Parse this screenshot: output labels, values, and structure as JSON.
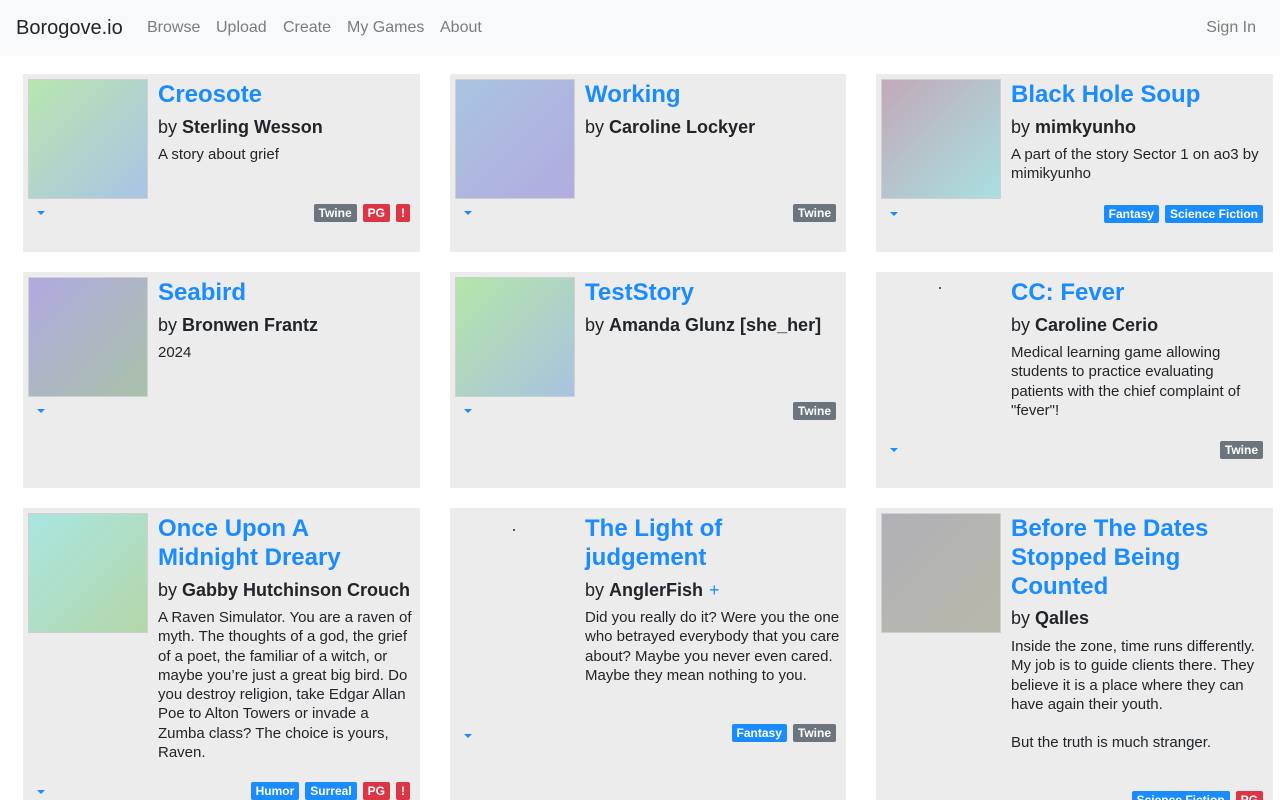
{
  "nav": {
    "brand": "Borogove.io",
    "links": [
      "Browse",
      "Upload",
      "Create",
      "My Games",
      "About"
    ],
    "sign_in": "Sign In"
  },
  "games": [
    {
      "title": "Creosote",
      "by": "by",
      "author": "Sterling Wesson",
      "description": [
        "A story about grief"
      ],
      "tags": [
        {
          "label": "Twine",
          "color": "#6c757d"
        },
        {
          "label": "PG",
          "color": "#dc3545"
        },
        {
          "label": "!",
          "color": "#dc3545"
        }
      ],
      "cover_gradient": [
        "#b8e6b0",
        "#a9c4e6"
      ]
    },
    {
      "title": "Working",
      "by": "by",
      "author": "Caroline Lockyer",
      "description": [],
      "tags": [
        {
          "label": "Twine",
          "color": "#6c757d"
        }
      ],
      "cover_gradient": [
        "#a9c4e0",
        "#b2abe0"
      ]
    },
    {
      "title": "Black Hole Soup",
      "by": "by",
      "author": "mimkyunho",
      "description": [
        "A part of the story Sector 1 on ao3 by mimikyunho"
      ],
      "tags": [
        {
          "label": "Fantasy",
          "color": "#1a8cff"
        },
        {
          "label": "Science Fiction",
          "color": "#1a8cff"
        }
      ],
      "cover_gradient": [
        "#c2a9b8",
        "#a9e0e0"
      ]
    },
    {
      "title": "Seabird",
      "by": "by",
      "author": "Bronwen Frantz",
      "description": [
        "2024"
      ],
      "tags": [],
      "cover_gradient": [
        "#b0a9e0",
        "#a9c2a9"
      ]
    },
    {
      "title": "TestStory",
      "by": "by",
      "author": "Amanda Glunz [she_her]",
      "description": [],
      "tags": [
        {
          "label": "Twine",
          "color": "#6c757d"
        }
      ],
      "cover_gradient": [
        "#b4e6a9",
        "#a9c2e0"
      ]
    },
    {
      "title": "CC: Fever",
      "by": "by",
      "author": "Caroline Cerio",
      "description": [
        "Medical learning game allowing students to practice evaluating patients with the chief complaint of \"fever\"!"
      ],
      "tags": [
        {
          "label": "Twine",
          "color": "#6c757d"
        }
      ],
      "cover_gradient": []
    },
    {
      "title": "Once Upon A Midnight Dreary",
      "by": "by",
      "author": "Gabby Hutchinson Crouch",
      "description": [
        "A Raven Simulator. You are a raven of myth. The thoughts of a god, the grief of a poet, the familiar of a witch, or maybe you’re just a great big bird. Do you destroy religion, take Edgar Allan Poe to Alton Towers or invade a Zumba class? The choice is yours, Raven."
      ],
      "tags": [
        {
          "label": "Humor",
          "color": "#1a8cff"
        },
        {
          "label": "Surreal",
          "color": "#1a8cff"
        },
        {
          "label": "PG",
          "color": "#dc3545"
        },
        {
          "label": "!",
          "color": "#dc3545"
        }
      ],
      "cover_gradient": [
        "#a9e6e0",
        "#b4d6a9"
      ]
    },
    {
      "title": "The Light of judgement",
      "by": "by",
      "author": "AnglerFish",
      "author_extra": "+",
      "description": [
        "Did you really do it? Were you the one who betrayed everybody that you care about? Maybe you never even cared. Maybe they mean nothing to you."
      ],
      "tags": [
        {
          "label": "Fantasy",
          "color": "#1a8cff"
        },
        {
          "label": "Twine",
          "color": "#6c757d"
        }
      ],
      "cover_gradient": []
    },
    {
      "title": "Before The Dates Stopped Being Counted",
      "by": "by",
      "author": "Qalles",
      "description": [
        "Inside the zone, time runs differently. My job is to guide clients there. They believe it is a place where they can have again their youth.",
        "But the truth is much stranger."
      ],
      "tags": [
        {
          "label": "Science Fiction",
          "color": "#1a8cff"
        },
        {
          "label": "PG",
          "color": "#dc3545"
        }
      ],
      "cover_gradient": [
        "#b0b0b8",
        "#b8b8a9"
      ]
    }
  ]
}
